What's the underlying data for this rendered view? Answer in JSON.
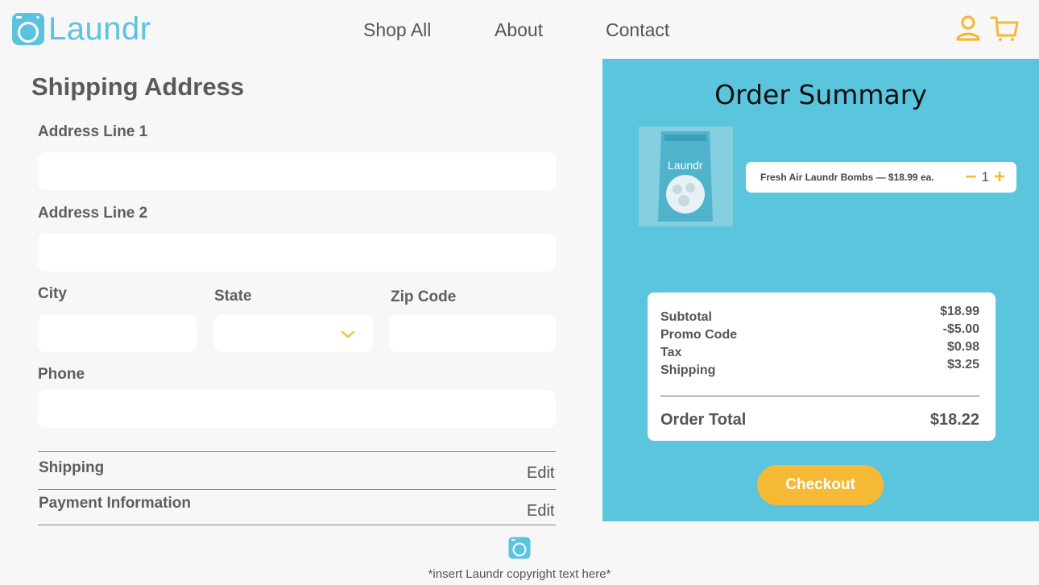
{
  "brand": {
    "name": "Laundr"
  },
  "nav": {
    "items": [
      "Shop All",
      "About",
      "Contact"
    ]
  },
  "icons": {
    "account": "user-icon",
    "cart": "cart-icon",
    "logo": "washing-machine-icon",
    "dropdown": "chevron-down-icon"
  },
  "colors": {
    "accent_blue": "#5bc5de",
    "accent_yellow": "#f5b935",
    "background": "#f7f7f7"
  },
  "shipping_form": {
    "title": "Shipping Address",
    "address1_label": "Address Line 1",
    "address1_value": "",
    "address2_label": "Address Line 2",
    "address2_value": "",
    "city_label": "City",
    "city_value": "",
    "state_label": "State",
    "state_value": "",
    "zip_label": "Zip Code",
    "zip_value": "",
    "phone_label": "Phone",
    "phone_value": ""
  },
  "sections": [
    {
      "title": "Shipping",
      "action": "Edit"
    },
    {
      "title": "Payment Information",
      "action": "Edit"
    }
  ],
  "order_summary": {
    "title": "Order Summary",
    "item": {
      "name": "Fresh Air Laundr Bombs — $18.99 ea.",
      "quantity": "1",
      "image_label": "Laundr"
    },
    "lines": [
      {
        "label": "Subtotal",
        "value": "$18.99"
      },
      {
        "label": "Promo Code",
        "value": "-$5.00"
      },
      {
        "label": "Tax",
        "value": "$0.98"
      },
      {
        "label": "Shipping",
        "value": "$3.25"
      }
    ],
    "total_label": "Order Total",
    "total_value": "$18.22",
    "checkout_label": "Checkout"
  },
  "footer": {
    "copyright": "*insert Laundr copyright text here*"
  }
}
